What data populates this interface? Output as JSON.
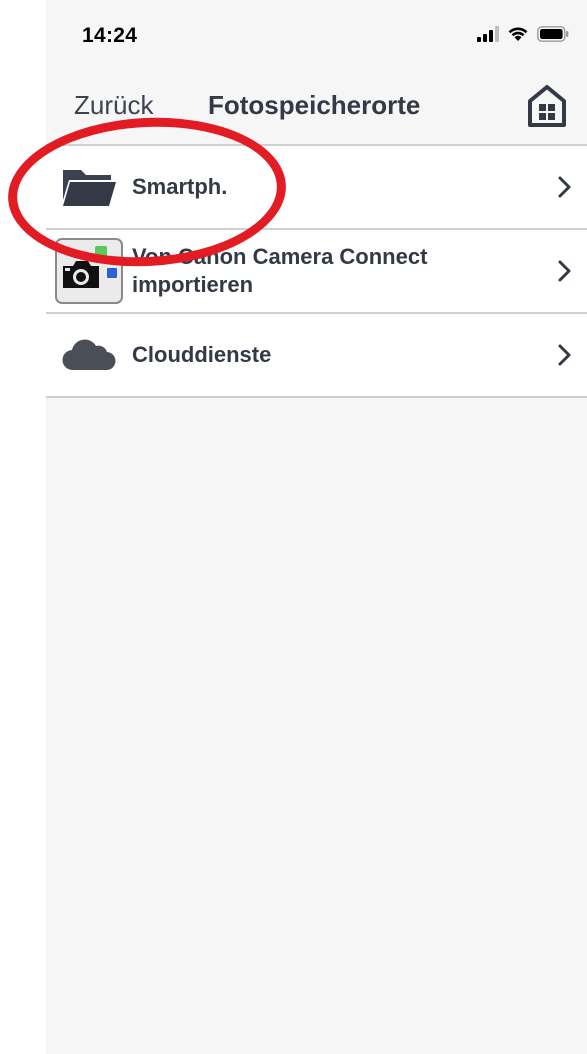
{
  "status_bar": {
    "time": "14:24"
  },
  "nav": {
    "back_label": "Zurück",
    "title": "Fotospeicherorte",
    "home_icon": "home-icon"
  },
  "list": {
    "items": [
      {
        "label": "Smartph.",
        "icon": "folder-icon"
      },
      {
        "label": "Von Canon Camera Connect importieren",
        "icon": "camera-connect-icon"
      },
      {
        "label": "Clouddienste",
        "icon": "cloud-icon"
      }
    ]
  },
  "colors": {
    "text": "#333a46",
    "background": "#f6f6f6",
    "separator": "#cfcfcf",
    "annotation": "#e31b23"
  }
}
